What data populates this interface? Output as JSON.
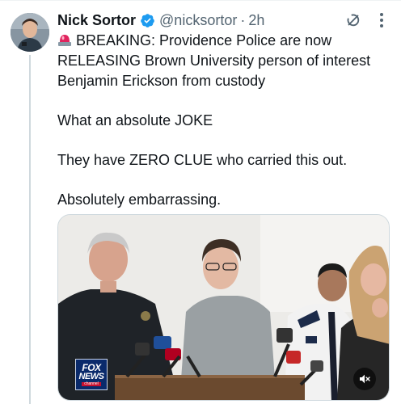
{
  "tweet": {
    "author_name": "Nick Sortor",
    "handle": "@nicksortor",
    "separator": "·",
    "time": "2h",
    "lines": [
      "BREAKING: Providence Police are now",
      "RELEASING Brown University person of interest",
      "Benjamin Erickson from custody",
      "What an absolute JOKE",
      "They have ZERO CLUE who carried this out.",
      "Absolutely embarrassing."
    ],
    "media": {
      "logo_line1": "FOX",
      "logo_line2": "NEWS",
      "logo_line3": "channel"
    }
  },
  "icons": {
    "verified": "verified-badge-icon",
    "grok": "grok-icon",
    "more": "more-options-icon",
    "siren": "siren-emoji",
    "mute": "mute-icon"
  },
  "colors": {
    "verified": "#1d9bf0",
    "text": "#0f1419",
    "secondary": "#536471",
    "fox_blue": "#0a2a6b",
    "fox_red": "#c8102e"
  }
}
